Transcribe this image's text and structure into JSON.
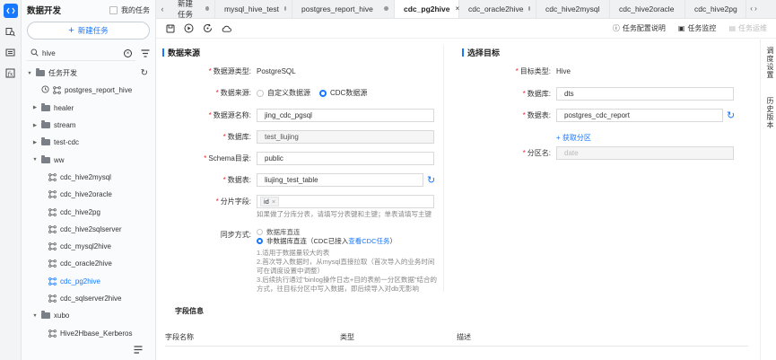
{
  "rail": {
    "icons": [
      "data-dev-icon",
      "search-tree-icon",
      "list-icon",
      "function-icon"
    ]
  },
  "tree": {
    "title": "数据开发",
    "my_tasks_label": "我的任务",
    "new_task_label": "新建任务",
    "search_value": "hive",
    "root_label": "任务开发",
    "nodes": [
      {
        "label": "postgres_report_hive",
        "type": "flow",
        "level": 1
      },
      {
        "label": "healer",
        "type": "folder",
        "level": 1
      },
      {
        "label": "stream",
        "type": "folder",
        "level": 1
      },
      {
        "label": "test-cdc",
        "type": "folder",
        "level": 1
      },
      {
        "label": "ww",
        "type": "folder-open",
        "level": 1
      },
      {
        "label": "cdc_hive2mysql",
        "type": "flow",
        "level": 2
      },
      {
        "label": "cdc_hive2oracle",
        "type": "flow",
        "level": 2
      },
      {
        "label": "cdc_hive2pg",
        "type": "flow",
        "level": 2
      },
      {
        "label": "cdc_hive2sqlserver",
        "type": "flow",
        "level": 2
      },
      {
        "label": "cdc_mysql2hive",
        "type": "flow",
        "level": 2
      },
      {
        "label": "cdc_oracle2hive",
        "type": "flow",
        "level": 2
      },
      {
        "label": "cdc_pg2hive",
        "type": "flow",
        "level": 2,
        "selected": true
      },
      {
        "label": "cdc_sqlserver2hive",
        "type": "flow",
        "level": 2
      },
      {
        "label": "xubo",
        "type": "folder-open",
        "level": 1
      },
      {
        "label": "Hive2Hbase_Kerberos",
        "type": "flow",
        "level": 2
      }
    ]
  },
  "tabs": [
    {
      "label": "新建任务",
      "active": false
    },
    {
      "label": "mysql_hive_test",
      "active": false
    },
    {
      "label": "postgres_report_hive",
      "active": false
    },
    {
      "label": "cdc_pg2hive",
      "active": true
    },
    {
      "label": "cdc_oracle2hive",
      "active": false
    },
    {
      "label": "cdc_hive2mysql",
      "active": false
    },
    {
      "label": "cdc_hive2oracle",
      "active": false
    },
    {
      "label": "cdc_hive2pg",
      "active": false
    }
  ],
  "toolbar": {
    "config_desc": "任务配置说明",
    "monitor": "任务监控",
    "offline": "任务运维"
  },
  "source": {
    "title": "数据来源",
    "type_label": "数据源类型:",
    "type_value": "PostgreSQL",
    "ds_label": "数据来源:",
    "ds_opt1": "自定义数据源",
    "ds_opt2": "CDC数据源",
    "name_label": "数据源名称:",
    "name_value": "jing_cdc_pgsql",
    "db_label": "数据库:",
    "db_value": "test_liujing",
    "schema_label": "Schema目录:",
    "schema_value": "public",
    "table_label": "数据表:",
    "table_value": "liujing_test_table",
    "shard_label": "分片字段:",
    "shard_tag": "id",
    "shard_hint": "如果做了分库分表，请填写分表键和主键；单表请填写主键",
    "sync_label": "同步方式:",
    "sync_opt1": "数据库直连",
    "sync_opt2": "非数据库直连（CDC已接入",
    "sync_link": "查看CDC任务",
    "sync_opt2_end": "）",
    "notes": [
      "1.适用于数据量较大的表",
      "2.首次导入数据时，从mysql直接拉取（首次导入的业务时间",
      "可在调度设置中调整）",
      "3.后续执行通过\"binlog操作日志+目的表前一分区数据\"结合的",
      "方式，往目标分区中写入数据，即后续导入对db无影响"
    ]
  },
  "target": {
    "title": "选择目标",
    "type_label": "目标类型:",
    "type_value": "Hive",
    "db_label": "数据库:",
    "db_value": "dts",
    "table_label": "数据表:",
    "table_value": "postgres_cdc_report",
    "get_partition": "+ 获取分区",
    "partition_label": "分区名:",
    "partition_placeholder": "date"
  },
  "fields": {
    "title": "字段信息",
    "headers": [
      "字段名称",
      "类型",
      "描述"
    ]
  },
  "right_panel": {
    "schedule": "调度设置",
    "history": "历史版本"
  }
}
